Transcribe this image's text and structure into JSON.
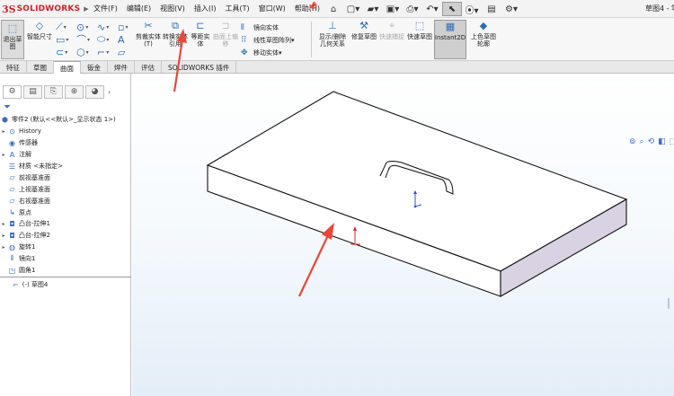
{
  "app": {
    "logo_ds": "3S",
    "logo_text": "SOLIDWORKS",
    "document_title": "草图4 - 零",
    "menus": [
      "文件(F)",
      "编辑(E)",
      "视图(V)",
      "插入(I)",
      "工具(T)",
      "窗口(W)",
      "帮助(H)"
    ]
  },
  "ribbon": {
    "exit_sketch": "退出草图",
    "smart_dimension": "智能尺寸",
    "trim": "剪裁实体(T)",
    "convert": "转换实体引用",
    "offset": "等距实体",
    "offset_on_surface": "曲面上偏移",
    "mirror": "镜向实体",
    "linear_pattern": "线性草图阵列",
    "move": "移动实体",
    "show_relations": "显示/删除几何关系",
    "repair": "修复草图",
    "quick_snap": "快速捕捉",
    "rapid_sketch": "快速草图",
    "instant2d": "Instant2D",
    "shaded_contours": "上色草图轮廓"
  },
  "tabs": [
    "特征",
    "草图",
    "曲面",
    "钣金",
    "焊件",
    "评估",
    "SOLIDWORKS 插件"
  ],
  "tree": {
    "root": "零件2 (默认<<默认>_显示状态 1>)",
    "items": [
      {
        "label": "History",
        "icon": "history-icon"
      },
      {
        "label": "传感器",
        "icon": "sensor-icon"
      },
      {
        "label": "注解",
        "icon": "annotation-icon"
      },
      {
        "label": "材质 <未指定>",
        "icon": "material-icon"
      },
      {
        "label": "前视基准面",
        "icon": "plane-icon"
      },
      {
        "label": "上视基准面",
        "icon": "plane-icon"
      },
      {
        "label": "右视基准面",
        "icon": "plane-icon"
      },
      {
        "label": "原点",
        "icon": "origin-icon"
      },
      {
        "label": "凸台-拉伸1",
        "icon": "extrude-icon"
      },
      {
        "label": "凸台-拉伸2",
        "icon": "extrude-icon"
      },
      {
        "label": "旋转1",
        "icon": "revolve-icon"
      },
      {
        "label": "镜向1",
        "icon": "mirror-icon"
      },
      {
        "label": "圆角1",
        "icon": "fillet-icon"
      }
    ],
    "active_sketch": "(-) 草图4"
  },
  "colors": {
    "brand": "#d42027",
    "accent": "#2e6db4",
    "arrow": "#e8473a",
    "side_face": "#d9d2e3"
  }
}
